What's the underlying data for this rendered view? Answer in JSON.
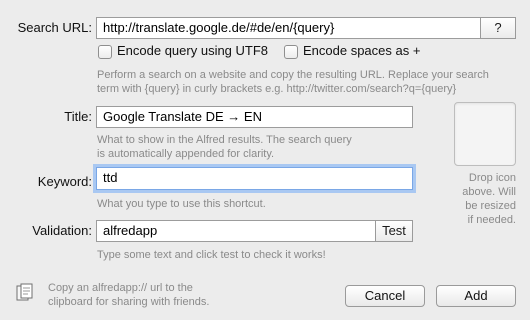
{
  "search_url": {
    "label": "Search URL:",
    "value": "http://translate.google.de/#de/en/{query}",
    "help_button": "?"
  },
  "options": {
    "encode_utf8": {
      "label": "Encode query using UTF8",
      "checked": false
    },
    "encode_spaces": {
      "label": "Encode spaces as +",
      "checked": false
    }
  },
  "search_url_hint_line1": "Perform a search on a website and copy the resulting URL. Replace your search",
  "search_url_hint_line2": "term with {query} in curly brackets e.g. http://twitter.com/search?q={query}",
  "title": {
    "label": "Title:",
    "value": "Google Translate DE → EN",
    "hint_line1": "What to show in the Alfred results. The search query",
    "hint_line2": "is automatically appended for clarity."
  },
  "keyword": {
    "label": "Keyword:",
    "value": "ttd",
    "hint": "What you type to use this shortcut."
  },
  "validation": {
    "label": "Validation:",
    "value": "alfredapp",
    "test_button": "Test",
    "hint": "Type some text and click test to check it works!"
  },
  "icon_drop": {
    "line1": "Drop icon",
    "line2": "above. Will",
    "line3": "be resized",
    "line4": "if needed."
  },
  "footer": {
    "copy_line1": "Copy an alfredapp:// url to the",
    "copy_line2": "clipboard for sharing with friends.",
    "cancel": "Cancel",
    "add": "Add"
  }
}
